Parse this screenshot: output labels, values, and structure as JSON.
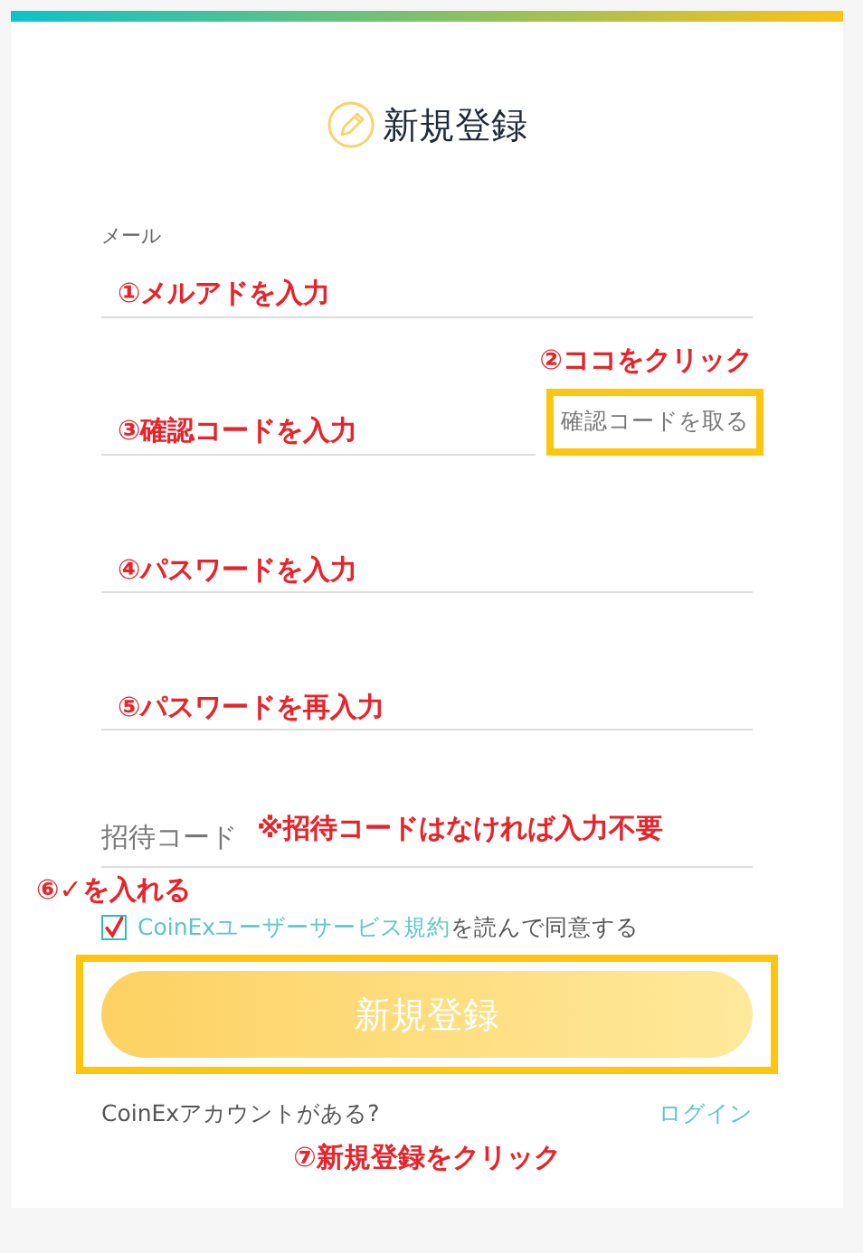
{
  "title": "新規登録",
  "fields": [
    {
      "kind": "email",
      "label": "メール",
      "note": "①メルアドを入力"
    },
    {
      "kind": "code",
      "note": "③確認コードを入力",
      "action": {
        "label": "確認コードを取る",
        "note": "②ココをクリック",
        "highlighted": true
      }
    },
    {
      "kind": "password",
      "note": "④パスワードを入力"
    },
    {
      "kind": "password",
      "note": "⑤パスワードを再入力"
    },
    {
      "kind": "invite",
      "placeholder": "招待コード",
      "note": "※招待コードはなければ入力不要"
    }
  ],
  "agreement": {
    "note": "⑥✓を入れる",
    "checked": true,
    "link": "CoinExユーザーサービス規約",
    "text": "を読んで同意する"
  },
  "submit": {
    "label": "新規登録",
    "highlighted": true,
    "note": "⑦新規登録をクリック"
  },
  "footer": {
    "question": "CoinExアカウントがある?",
    "link": "ログイン"
  }
}
